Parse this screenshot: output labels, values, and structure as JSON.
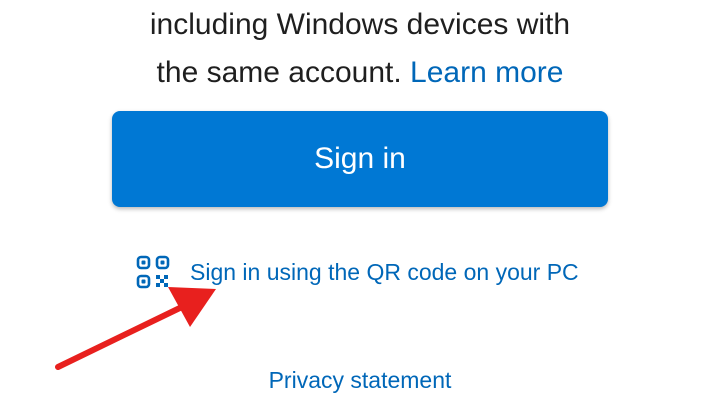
{
  "description": {
    "line1": "including Windows devices with",
    "line2": "the same account. ",
    "learn_more": "Learn more"
  },
  "sign_in_button": {
    "label": "Sign in"
  },
  "qr_sign_in": {
    "label": "Sign in using the QR code on your PC",
    "icon": "qr-code-icon"
  },
  "annotation": {
    "icon": "red-arrow-icon",
    "color": "#e8201e"
  },
  "footer": {
    "privacy_label": "Privacy statement"
  },
  "colors": {
    "accent": "#0078d4",
    "link": "#0067b8",
    "text": "#1f1f1f",
    "background": "#ffffff"
  }
}
